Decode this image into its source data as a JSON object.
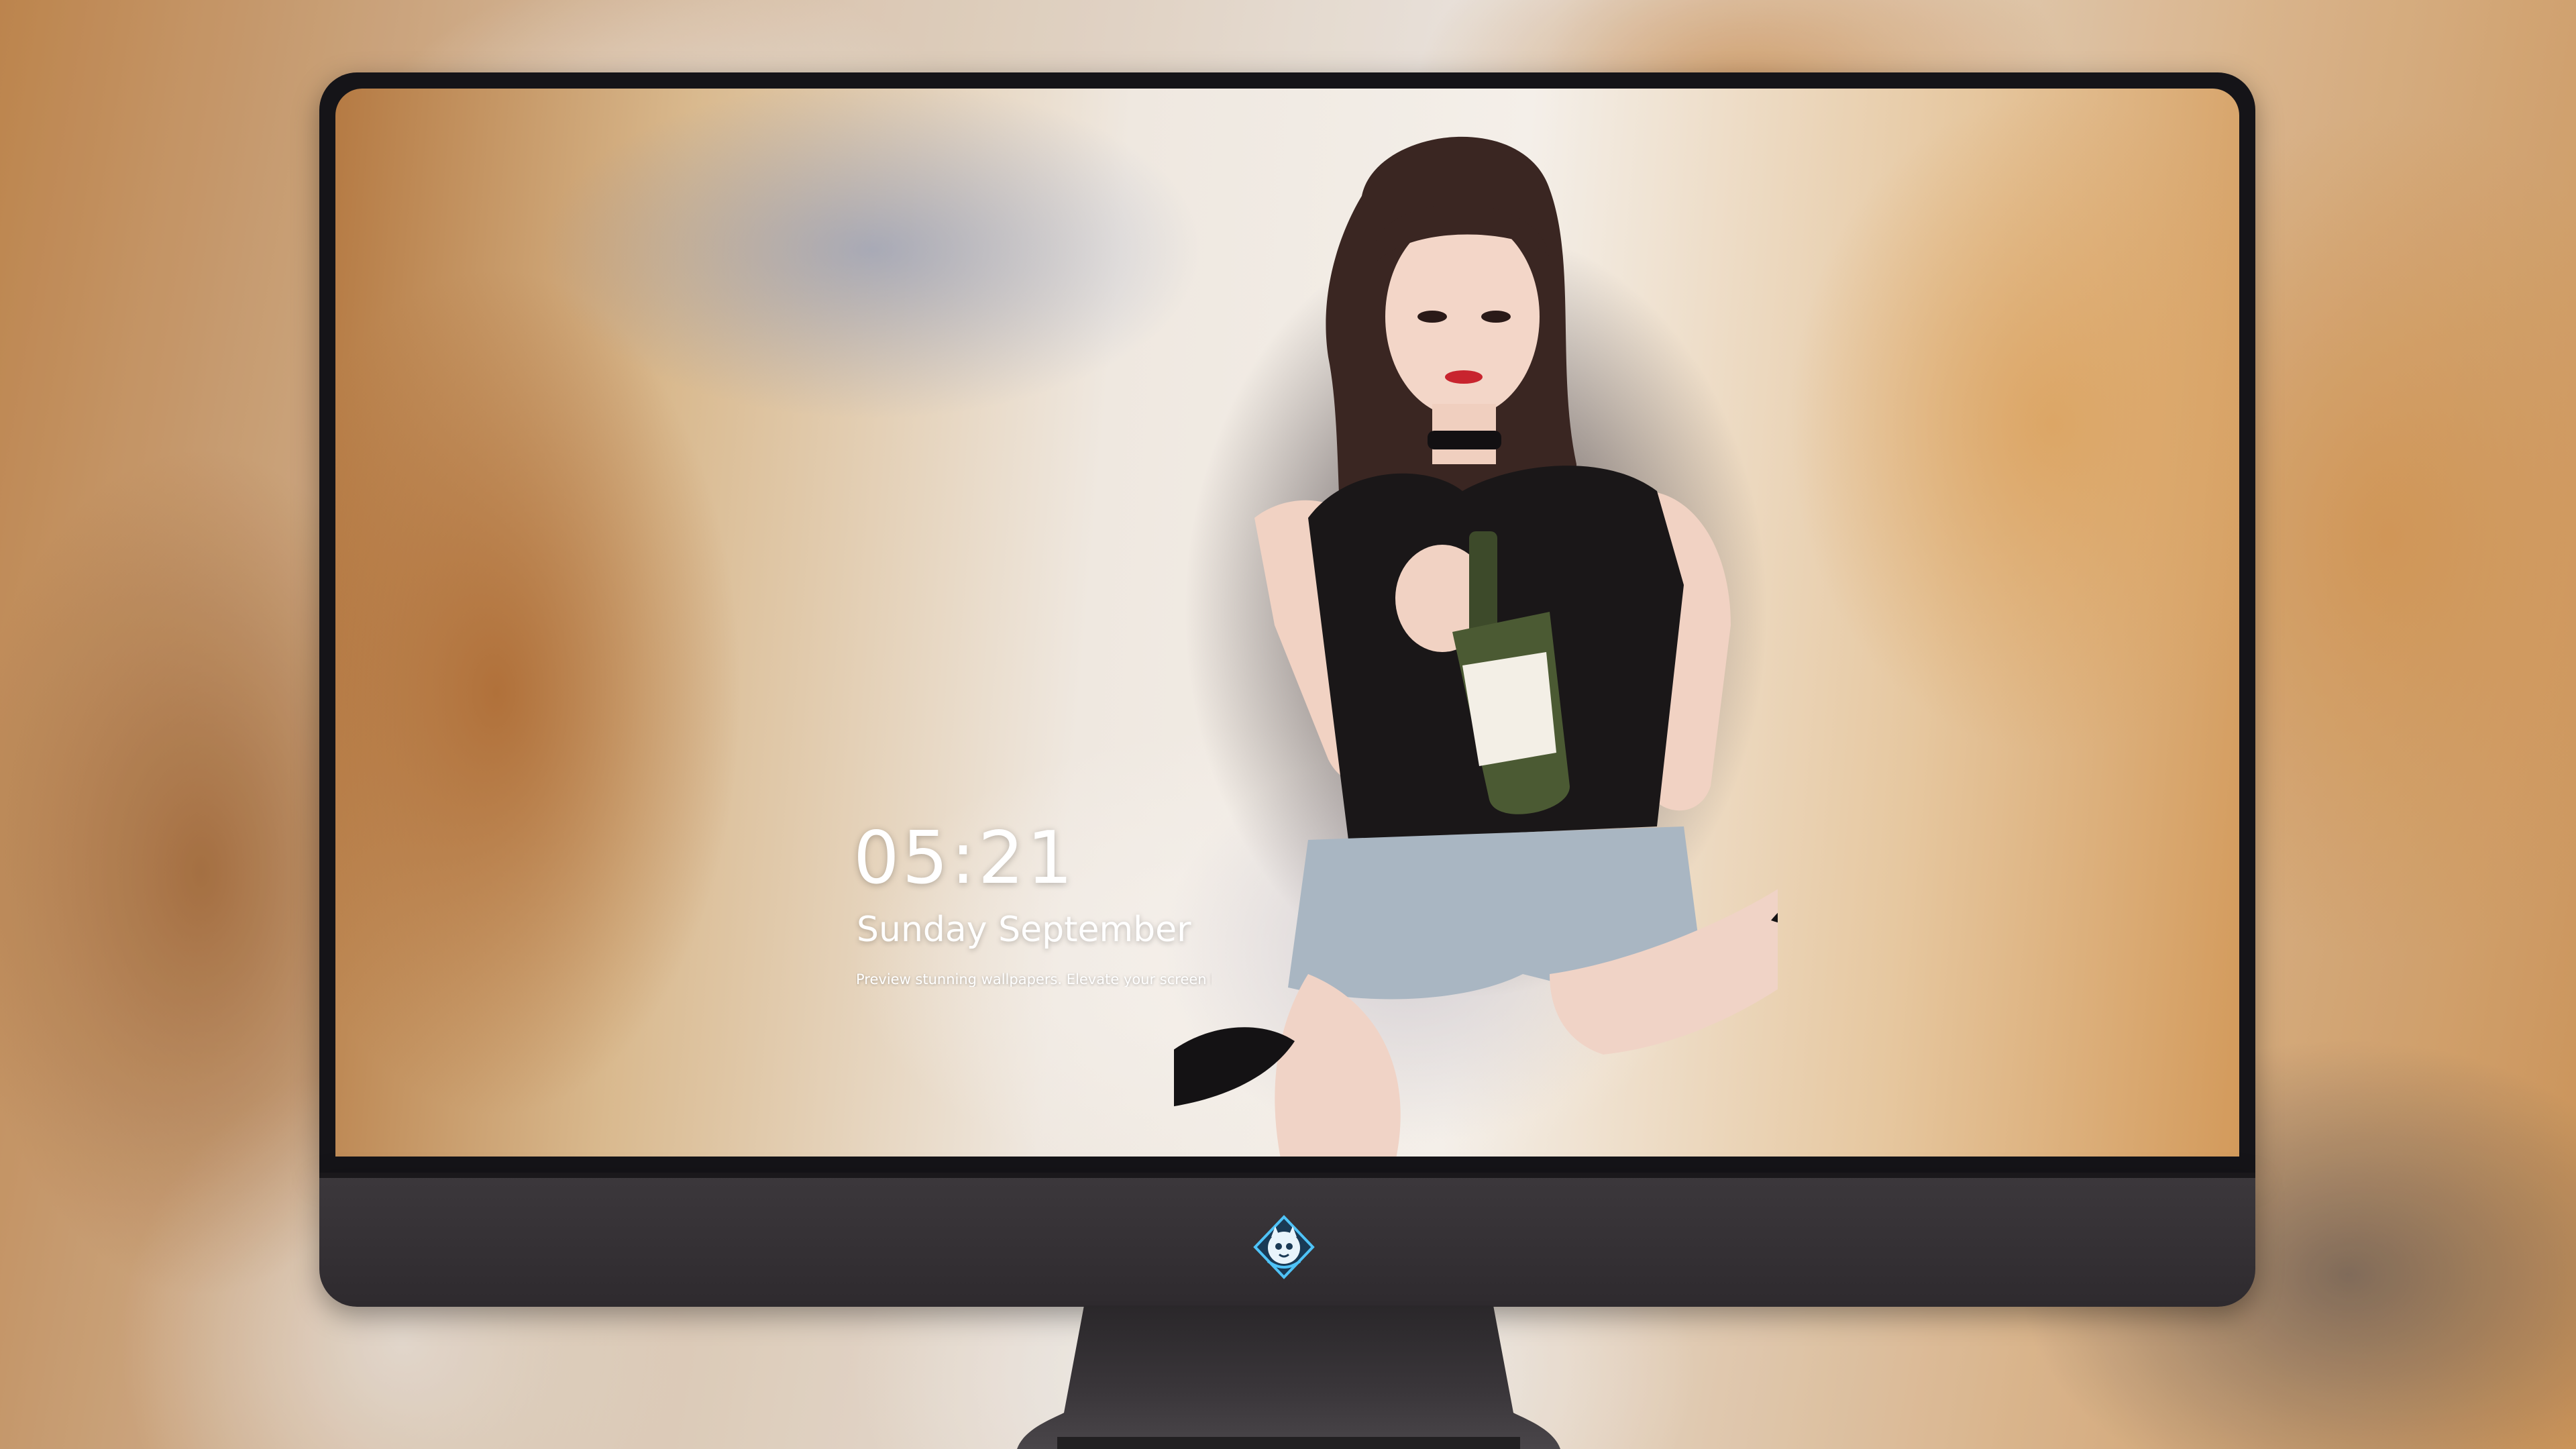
{
  "lockscreen": {
    "time": "05:21",
    "date": "Sunday September",
    "tagline": "Preview stunning wallpapers. Elevate your screen bo"
  },
  "dock": {
    "apps": [
      {
        "name": "messages-icon",
        "color": "#2ecc40"
      },
      {
        "name": "weather-icon",
        "color": "#2e8cf0"
      },
      {
        "name": "clock-icon",
        "color": "#ffffff"
      },
      {
        "name": "preview-icon",
        "color": "#3b7bd9"
      },
      {
        "name": "video-clips-icon",
        "color": "#2aa8e0"
      },
      {
        "name": "notes-icon",
        "color": "#ffd23f"
      },
      {
        "name": "photo-booth-icon",
        "color": "#c83a3a"
      },
      {
        "name": "itunes-icon",
        "color": "#d63fd6"
      },
      {
        "name": "app-store-icon",
        "color": "#1f8ff5"
      },
      {
        "name": "camera-icon",
        "color": "#5a5a5a"
      }
    ]
  },
  "monitor": {
    "bezel_color": "#151418",
    "chin_color": "#363236",
    "logo": "mascot-logo-icon"
  }
}
